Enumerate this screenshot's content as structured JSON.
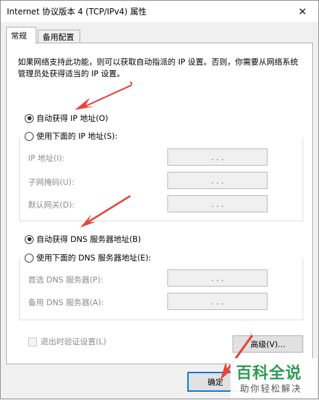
{
  "window": {
    "title": "Internet 协议版本 4 (TCP/IPv4) 属性",
    "close_glyph": "✕"
  },
  "tabs": [
    {
      "label": "常规",
      "active": true
    },
    {
      "label": "备用配置",
      "active": false
    }
  ],
  "description": "如果网络支持此功能，则可以获取自动指派的 IP 设置。否则，你需要从网络系统管理员处获得适当的 IP 设置。",
  "ip": {
    "auto_label": "自动获得 IP 地址(O)",
    "manual_label": "使用下面的 IP 地址(S):",
    "auto_selected": true,
    "fields": [
      {
        "label": "IP 地址(I):",
        "dots": ".     .     ."
      },
      {
        "label": "子网掩码(U):",
        "dots": ".     .     ."
      },
      {
        "label": "默认网关(D):",
        "dots": ".     .     ."
      }
    ]
  },
  "dns": {
    "auto_label": "自动获得 DNS 服务器地址(B)",
    "manual_label": "使用下面的 DNS 服务器地址(E):",
    "auto_selected": true,
    "fields": [
      {
        "label": "首选 DNS 服务器(P):",
        "dots": ".     .     ."
      },
      {
        "label": "备用 DNS 服务器(A):",
        "dots": ".     .     ."
      }
    ]
  },
  "validate_label": "退出时验证设置(L)",
  "advanced_label": "高级(V)...",
  "ok_label": "确定",
  "watermark": {
    "main": "百科全说",
    "sub": "助你轻松解决"
  },
  "colors": {
    "arrow": "#e8453c",
    "focus": "#0078d7",
    "brand": "#2e9b55"
  }
}
